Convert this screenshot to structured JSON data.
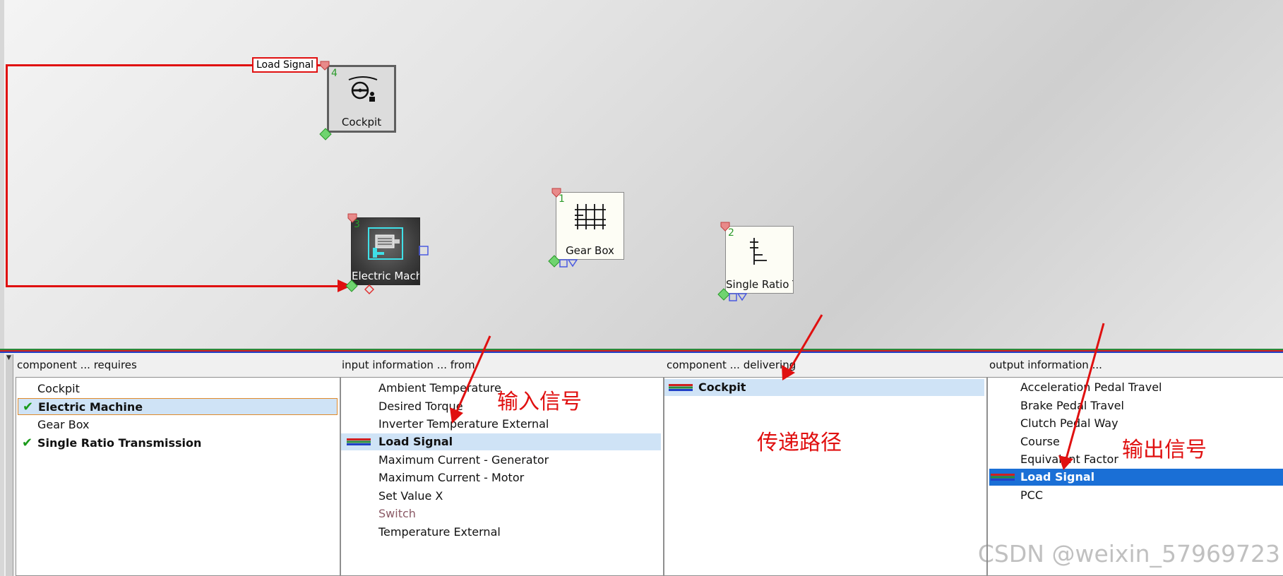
{
  "canvas": {
    "components": [
      {
        "id": "cockpit",
        "num": "4",
        "label": "Cockpit",
        "icon": "steering-wheel-driver-icon"
      },
      {
        "id": "electric-machine",
        "num": "3",
        "label": "Electric Mach",
        "icon": "electric-motor-icon"
      },
      {
        "id": "gear-box",
        "num": "1",
        "label": "Gear Box",
        "icon": "gearbox-icon"
      },
      {
        "id": "single-ratio",
        "num": "2",
        "label": "Single Ratio T",
        "icon": "single-ratio-transmission-icon"
      }
    ],
    "connection_label": "Load Signal",
    "wire_color": "#e01010"
  },
  "panels": {
    "requires": {
      "header": "component ... requires",
      "items": [
        {
          "label": "Cockpit",
          "checked": false
        },
        {
          "label": "Electric Machine",
          "checked": true
        },
        {
          "label": "Gear Box",
          "checked": false
        },
        {
          "label": "Single Ratio Transmission",
          "checked": true
        }
      ]
    },
    "input": {
      "header": "input information ... from",
      "items": [
        {
          "label": "Ambient Temperature"
        },
        {
          "label": "Desired Torque"
        },
        {
          "label": "Inverter Temperature External"
        },
        {
          "label": "Load Signal"
        },
        {
          "label": "Maximum Current - Generator"
        },
        {
          "label": "Maximum Current - Motor"
        },
        {
          "label": "Set Value X"
        },
        {
          "label": "Switch"
        },
        {
          "label": "Temperature External"
        }
      ]
    },
    "delivering": {
      "header": "component ... delivering",
      "items": [
        {
          "label": "Cockpit"
        }
      ]
    },
    "output": {
      "header": "output information ...",
      "items": [
        {
          "label": "Acceleration Pedal Travel"
        },
        {
          "label": "Brake Pedal Travel"
        },
        {
          "label": "Clutch Pedal Way"
        },
        {
          "label": "Course"
        },
        {
          "label": "Equivalent Factor"
        },
        {
          "label": "Load Signal"
        },
        {
          "label": "PCC"
        }
      ]
    }
  },
  "annotations": {
    "input_signal": "输入信号",
    "transfer_path": "传递路径",
    "output_signal": "输出信号",
    "color": "#e01010"
  },
  "watermark": "CSDN @weixin_57969723",
  "colors": {
    "selection": "#1a6fd6",
    "highlight": "#cfe3f6",
    "check": "#1a9a1a"
  }
}
